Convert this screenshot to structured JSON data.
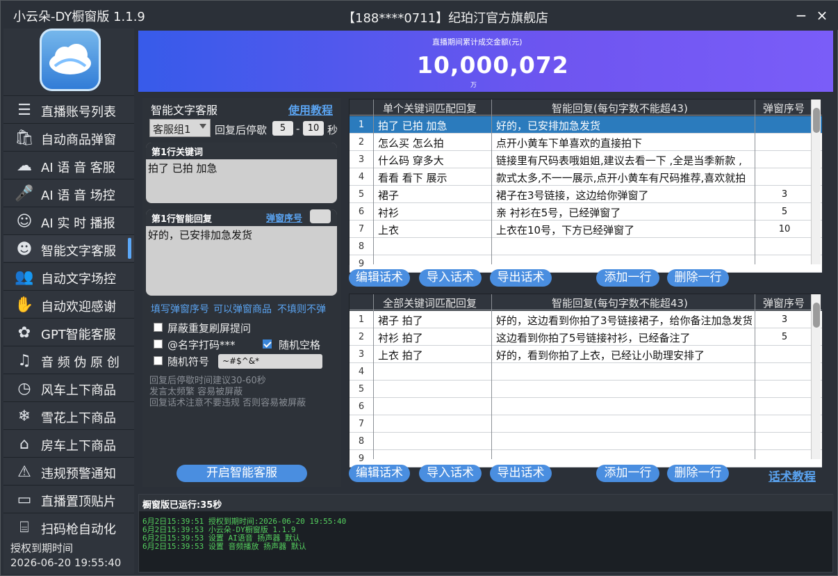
{
  "window": {
    "app_title": "小云朵-DY橱窗版 1.1.9",
    "shop": "【188****0711】纪珀汀官方旗舰店",
    "min": "−",
    "close": "×"
  },
  "sidebar": {
    "items": [
      {
        "label": "直播账号列表",
        "icon": "account-list-icon"
      },
      {
        "label": "自动商品弹窗",
        "icon": "shopping-bag-icon"
      },
      {
        "label": "AI 语 音 客服",
        "icon": "ai-voice-service-icon"
      },
      {
        "label": "AI 语 音 场控",
        "icon": "microphone-icon"
      },
      {
        "label": "AI 实 时 播报",
        "icon": "broadcaster-icon"
      },
      {
        "label": "智能文字客服",
        "icon": "text-service-icon"
      },
      {
        "label": "自动文字场控",
        "icon": "users-icon"
      },
      {
        "label": "自动欢迎感谢",
        "icon": "wave-hand-icon"
      },
      {
        "label": "GPT智能客服",
        "icon": "gpt-icon"
      },
      {
        "label": "音 频 伪 原 创",
        "icon": "music-note-icon"
      },
      {
        "label": "风车上下商品",
        "icon": "clock-icon"
      },
      {
        "label": "雪花上下商品",
        "icon": "snowflake-icon"
      },
      {
        "label": "房车上下商品",
        "icon": "rv-store-icon"
      },
      {
        "label": "违规预警通知",
        "icon": "alarm-icon"
      },
      {
        "label": "直播置顶贴片",
        "icon": "sticker-icon"
      },
      {
        "label": "扫码枪自动化",
        "icon": "scan-icon"
      }
    ],
    "expire_label": "授权到期时间",
    "expire_value": "2026-06-20 19:55:40"
  },
  "banner": {
    "caption": "直播期间累计成交金额(元)",
    "amount": "10,000,072",
    "unit": "万"
  },
  "left": {
    "title": "智能文字客服",
    "tutorial": "使用教程",
    "group": "客服组1",
    "pause_label": "回复后停歇",
    "pause_min": "5",
    "dash": "-",
    "pause_max": "10",
    "sec": "秒",
    "kw_head": "第1行关键词",
    "kw_text": "拍了 已拍 加急",
    "reply_head": "第1行智能回复",
    "popup_link": "弹窗序号",
    "reply_text": "好的，已安排加急发货",
    "hint_a": "填写弹窗序号",
    "hint_b": "可以弹窗商品",
    "hint_c": "不填则不弹",
    "cb1": "屏蔽重复刷屏提问",
    "cb2": "@名字打码***",
    "cb3": "随机空格",
    "cb4": "随机符号",
    "symbols": "~#$^&*",
    "note1": "回复后停歇时间建议30-60秒",
    "note2": "发言太频繁  容易被屏蔽",
    "note3": "回复话术注意不要违规 否则容易被屏蔽",
    "start": "开启智能客服"
  },
  "table1": {
    "headers": [
      "单个关键词匹配回复",
      "智能回复(每句字数不能超43)",
      "弹窗序号"
    ],
    "rows": [
      {
        "i": "1",
        "k": "拍了 已拍 加急",
        "r": "好的，已安排加急发货",
        "n": ""
      },
      {
        "i": "2",
        "k": "怎么买 怎么拍",
        "r": "点开小黄车下单喜欢的直接拍下",
        "n": ""
      },
      {
        "i": "3",
        "k": "什么码 穿多大",
        "r": "链接里有尺码表哦姐姐,建议去看一下 ,全是当季新款 ,",
        "n": ""
      },
      {
        "i": "4",
        "k": "看看 看下 展示",
        "r": "款式太多,不一一展示,点开小黄车有尺码推荐,喜欢就拍",
        "n": ""
      },
      {
        "i": "5",
        "k": "裙子",
        "r": "裙子在3号链接，这边给你弹窗了",
        "n": "3"
      },
      {
        "i": "6",
        "k": "衬衫",
        "r": "亲 衬衫在5号，已经弹窗了",
        "n": "5"
      },
      {
        "i": "7",
        "k": "上衣",
        "r": "上衣在10号，下方已经弹窗了",
        "n": "10"
      },
      {
        "i": "8",
        "k": "",
        "r": "",
        "n": ""
      },
      {
        "i": "9",
        "k": "",
        "r": "",
        "n": ""
      }
    ]
  },
  "table2": {
    "headers": [
      "全部关键词匹配回复",
      "智能回复(每句字数不能超43)",
      "弹窗序号"
    ],
    "rows": [
      {
        "i": "1",
        "k": "裙子 拍了",
        "r": "好的，这边看到你拍了3号链接裙子，给你备注加急发货",
        "n": "3"
      },
      {
        "i": "2",
        "k": "衬衫 拍了",
        "r": "这边看到你拍了5号链接衬衫，已经备注了",
        "n": "5"
      },
      {
        "i": "3",
        "k": "上衣 拍了",
        "r": "好的，看到你拍了上衣，已经让小助理安排了",
        "n": ""
      },
      {
        "i": "4",
        "k": "",
        "r": "",
        "n": ""
      },
      {
        "i": "5",
        "k": "",
        "r": "",
        "n": ""
      },
      {
        "i": "6",
        "k": "",
        "r": "",
        "n": ""
      },
      {
        "i": "7",
        "k": "",
        "r": "",
        "n": ""
      },
      {
        "i": "8",
        "k": "",
        "r": "",
        "n": ""
      },
      {
        "i": "9",
        "k": "",
        "r": "",
        "n": ""
      }
    ]
  },
  "actions": {
    "edit": "编辑话术",
    "import": "导入话术",
    "export": "导出话术",
    "add": "添加一行",
    "del": "删除一行",
    "tutorial": "话术教程"
  },
  "log": {
    "runtime": "橱窗版已运行:35秒",
    "lines": [
      "6月2日15:39:51 授权到期时间:2026-06-20 19:55:40",
      "6月2日15:39:53 小云朵-DY橱窗版 1.1.9",
      "6月2日15:39:53 设置 AI语音 扬声器 默认",
      "6月2日15:39:53 设置 音频播放 扬声器 默认"
    ]
  }
}
